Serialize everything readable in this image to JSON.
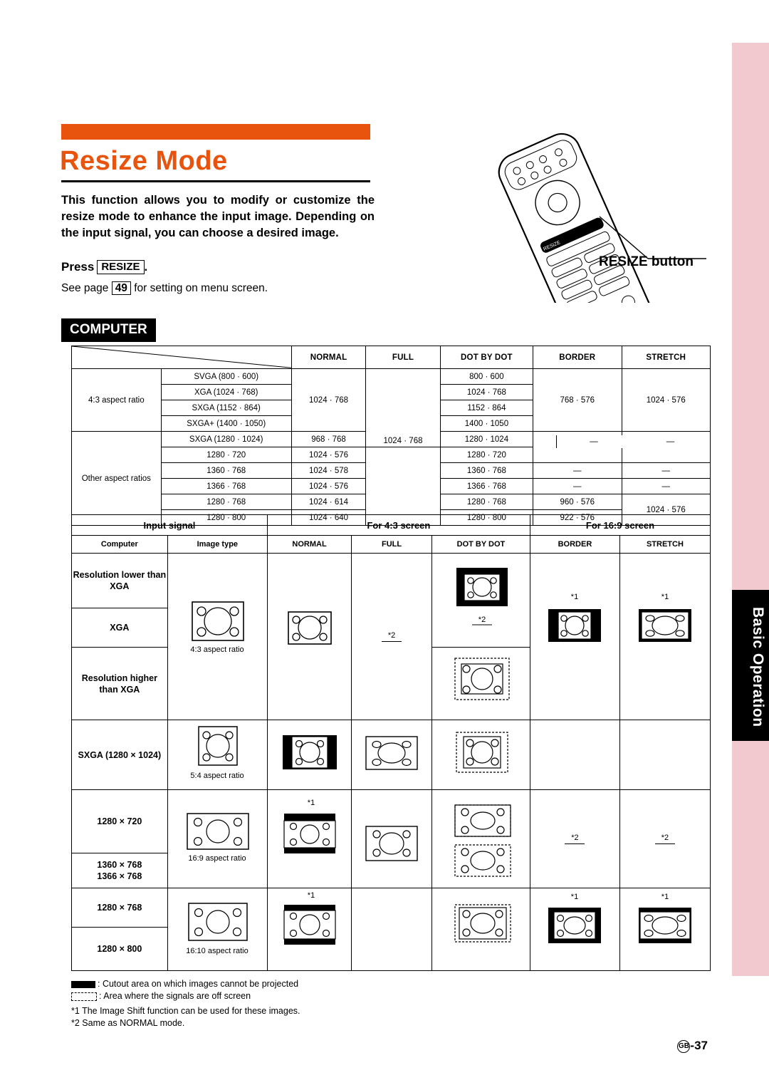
{
  "page": {
    "title": "Resize Mode",
    "intro": "This function allows you to modify or customize the resize mode to enhance the input image. Depending on the input signal, you can choose a desired image.",
    "press_label": "Press",
    "press_key": "RESIZE",
    "press_period": ".",
    "see_page_pre": "See page",
    "see_page_num": "49",
    "see_page_post": "for setting on menu screen.",
    "callout": "RESIZE button",
    "section_heading": "COMPUTER",
    "page_number": "-37",
    "page_region": "GB",
    "side_tab": "Basic Operation"
  },
  "table1": {
    "headers": [
      "NORMAL",
      "FULL",
      "DOT BY DOT",
      "BORDER",
      "STRETCH"
    ],
    "group1_label": "4:3 aspect ratio",
    "group2_label": "Other aspect ratios",
    "rows": [
      {
        "signal": "SVGA (800 · 600)",
        "normal": "1024 · 768",
        "full": "",
        "dot": "800 · 600",
        "border": "768 · 576",
        "stretch": "1024 · 576"
      },
      {
        "signal": "XGA (1024 · 768)",
        "normal": "",
        "full": "",
        "dot": "1024 · 768",
        "border": "",
        "stretch": ""
      },
      {
        "signal": "SXGA (1152 · 864)",
        "normal": "",
        "full": "",
        "dot": "1152 · 864",
        "border": "",
        "stretch": ""
      },
      {
        "signal": "SXGA+ (1400 · 1050)",
        "normal": "",
        "full": "",
        "dot": "1400 · 1050",
        "border": "",
        "stretch": ""
      },
      {
        "signal": "SXGA (1280 · 1024)",
        "normal": "968 · 768",
        "full": "1024 · 768",
        "dot": "1280 · 1024",
        "border": "",
        "stretch": ""
      },
      {
        "signal": "1280 · 720",
        "normal": "1024 · 576",
        "full": "",
        "dot": "1280 · 720",
        "border": "—",
        "stretch": "—"
      },
      {
        "signal": "1360 · 768",
        "normal": "1024 · 578",
        "full": "",
        "dot": "1360 · 768",
        "border": "—",
        "stretch": "—"
      },
      {
        "signal": "1366 · 768",
        "normal": "1024 · 576",
        "full": "",
        "dot": "1366 · 768",
        "border": "—",
        "stretch": "—"
      },
      {
        "signal": "1280 · 768",
        "normal": "1024 · 614",
        "full": "",
        "dot": "1280 · 768",
        "border": "960 · 576",
        "stretch": "1024 · 576"
      },
      {
        "signal": "1280 · 800",
        "normal": "1024 · 640",
        "full": "",
        "dot": "1280 · 800",
        "border": "922 · 576",
        "stretch": ""
      }
    ]
  },
  "table2": {
    "top_headers": [
      "Input signal",
      "For 4:3 screen",
      "For 16:9 screen"
    ],
    "sub_headers": [
      "Computer",
      "Image type",
      "NORMAL",
      "FULL",
      "DOT BY DOT",
      "BORDER",
      "STRETCH"
    ],
    "rows": [
      {
        "computer": "Resolution lower than XGA",
        "aspect": "4:3 aspect ratio"
      },
      {
        "computer": "XGA",
        "aspect": ""
      },
      {
        "computer": "Resolution higher than XGA",
        "aspect": ""
      },
      {
        "computer": "SXGA (1280 × 1024)",
        "aspect": "5:4 aspect ratio"
      },
      {
        "computer": "1280 × 720",
        "aspect": "16:9 aspect ratio"
      },
      {
        "computer": "1360 × 768",
        "computer2": "1366 × 768",
        "aspect": ""
      },
      {
        "computer": "1280 × 768",
        "aspect": ""
      },
      {
        "computer": "1280 × 800",
        "aspect": "16:10 aspect ratio"
      }
    ],
    "marks": {
      "star1": "*1",
      "star2": "*2",
      "dash": "—"
    }
  },
  "legend": {
    "line1": ": Cutout area on which images cannot be projected",
    "line2": ": Area where the signals are off screen",
    "note1": "*1 The Image Shift function can be used for these images.",
    "note2": "*2 Same as NORMAL mode."
  },
  "colors": {
    "accent": "#e8540e",
    "tab": "#f2c9cf",
    "black": "#000000"
  }
}
